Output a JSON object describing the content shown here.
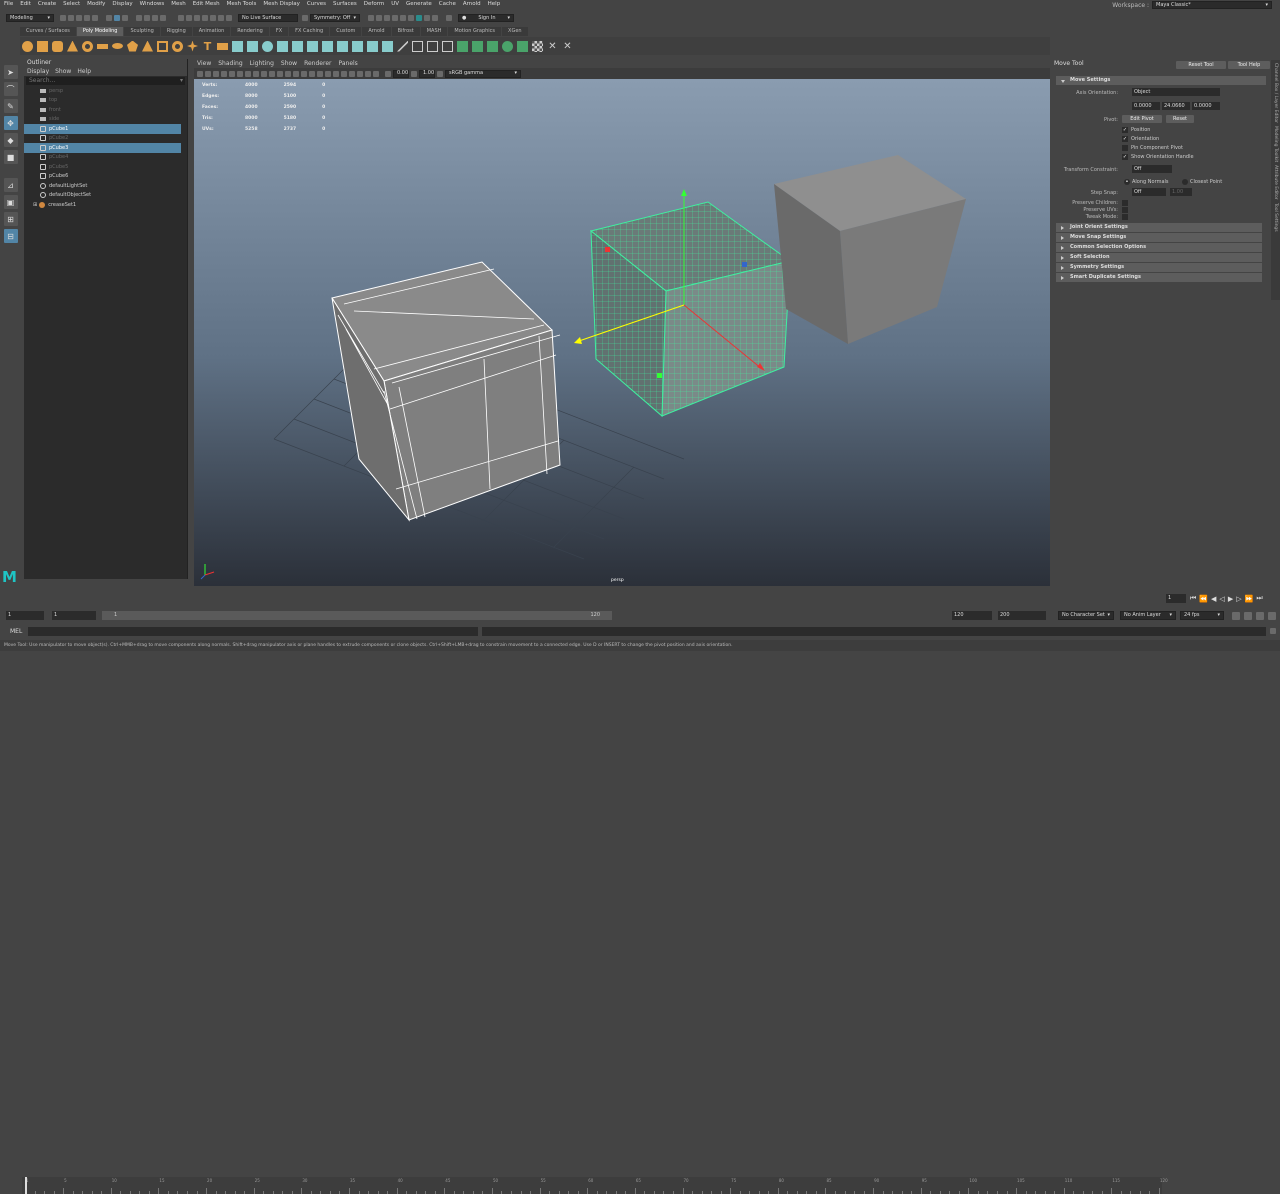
{
  "menubar": {
    "items": [
      "File",
      "Edit",
      "Create",
      "Select",
      "Modify",
      "Display",
      "Windows",
      "Mesh",
      "Edit Mesh",
      "Mesh Tools",
      "Mesh Display",
      "Curves",
      "Surfaces",
      "Deform",
      "UV",
      "Generate",
      "Cache",
      "Arnold",
      "Help"
    ],
    "workspace_label": "Workspace :",
    "workspace_value": "Maya Classic*"
  },
  "statusline": {
    "mode": "Modeling",
    "live_surface": "No Live Surface",
    "symmetry": "Symmetry: Off",
    "sign_in": "Sign In"
  },
  "shelf": {
    "tabs": [
      "Curves / Surfaces",
      "Poly Modeling",
      "Sculpting",
      "Rigging",
      "Animation",
      "Rendering",
      "FX",
      "FX Caching",
      "Custom",
      "Arnold",
      "Bifrost",
      "MASH",
      "Motion Graphics",
      "XGen"
    ],
    "active_tab": "Poly Modeling"
  },
  "outliner": {
    "title": "Outliner",
    "menu": [
      "Display",
      "Show",
      "Help"
    ],
    "search_placeholder": "Search...",
    "items": [
      {
        "label": "persp",
        "dim": true,
        "selected": false,
        "type": "camera"
      },
      {
        "label": "top",
        "dim": true,
        "selected": false,
        "type": "camera"
      },
      {
        "label": "front",
        "dim": true,
        "selected": false,
        "type": "camera"
      },
      {
        "label": "side",
        "dim": true,
        "selected": false,
        "type": "camera"
      },
      {
        "label": "pCube1",
        "dim": false,
        "selected": true,
        "type": "mesh"
      },
      {
        "label": "pCube2",
        "dim": true,
        "selected": false,
        "type": "mesh"
      },
      {
        "label": "pCube3",
        "dim": false,
        "selected": true,
        "type": "mesh"
      },
      {
        "label": "pCube4",
        "dim": true,
        "selected": false,
        "type": "mesh"
      },
      {
        "label": "pCube5",
        "dim": true,
        "selected": false,
        "type": "mesh"
      },
      {
        "label": "pCube6",
        "dim": false,
        "selected": false,
        "type": "mesh"
      },
      {
        "label": "defaultLightSet",
        "dim": false,
        "selected": false,
        "type": "set"
      },
      {
        "label": "defaultObjectSet",
        "dim": false,
        "selected": false,
        "type": "set"
      },
      {
        "label": "creaseSet1",
        "dim": false,
        "selected": false,
        "type": "crease"
      }
    ]
  },
  "viewport": {
    "menu": [
      "View",
      "Shading",
      "Lighting",
      "Show",
      "Renderer",
      "Panels"
    ],
    "exposure": "0.00",
    "gamma": "1.00",
    "color_space": "sRGB gamma",
    "camera_label": "persp",
    "hud": [
      {
        "label": "Verts:",
        "a": "4000",
        "b": "2594",
        "c": "0"
      },
      {
        "label": "Edges:",
        "a": "8000",
        "b": "5100",
        "c": "0"
      },
      {
        "label": "Faces:",
        "a": "4000",
        "b": "2590",
        "c": "0"
      },
      {
        "label": "Tris:",
        "a": "8000",
        "b": "5180",
        "c": "0"
      },
      {
        "label": "UVs:",
        "a": "5258",
        "b": "2737",
        "c": "0"
      }
    ]
  },
  "tool_settings": {
    "title": "Move Tool",
    "reset_label": "Reset Tool",
    "help_label": "Tool Help",
    "section_move": "Move Settings",
    "axis_orientation_label": "Axis Orientation:",
    "axis_orientation_value": "Object",
    "values": [
      "0.0000",
      "24.0660",
      "0.0000"
    ],
    "pivot_label": "Pivot:",
    "edit_pivot": "Edit Pivot",
    "reset": "Reset",
    "checks": [
      {
        "label": "Position",
        "checked": true
      },
      {
        "label": "Orientation",
        "checked": true
      },
      {
        "label": "Pin Component Pivot",
        "checked": false
      },
      {
        "label": "Show Orientation Handle",
        "checked": true
      }
    ],
    "transform_constraint_label": "Transform Constraint:",
    "transform_constraint_value": "Off",
    "along_normals": "Along Normals",
    "closest_point": "Closest Point",
    "step_snap_label": "Step Snap:",
    "step_snap_value": "Off",
    "step_snap_amount": "1.00",
    "preserve_children": "Preserve Children:",
    "preserve_uvs": "Preserve UVs:",
    "tweak_mode": "Tweak Mode:",
    "sections": [
      "Joint Orient Settings",
      "Move Snap Settings",
      "Common Selection Options",
      "Soft Selection",
      "Symmetry Settings",
      "Smart Duplicate Settings"
    ],
    "side_tabs": [
      "Channel Box / Layer Editor",
      "Modeling Toolkit",
      "Attribute Editor",
      "Tool Settings"
    ]
  },
  "timeslider": {
    "ticks": [
      "1",
      "5",
      "10",
      "15",
      "20",
      "25",
      "30",
      "35",
      "40",
      "45",
      "50",
      "55",
      "60",
      "65",
      "70",
      "75",
      "80",
      "85",
      "90",
      "95",
      "100",
      "105",
      "110",
      "115",
      "120"
    ],
    "current_frame": "1"
  },
  "rangebar": {
    "start": "1",
    "inner_start": "1",
    "range_start": "1",
    "range_end": "120",
    "end": "120",
    "anim_end": "200",
    "character_set": "No Character Set",
    "anim_layer": "No Anim Layer",
    "fps": "24 fps"
  },
  "cmdline": {
    "label": "MEL"
  },
  "helpline": {
    "text": "Move Tool: Use manipulator to move object(s). Ctrl+MMB+drag to move components along normals. Shift+drag manipulator axis or plane handles to extrude components or clone objects. Ctrl+Shift+LMB+drag to constrain movement to a connected edge. Use D or INSERT to change the pivot position and axis orientation."
  },
  "colors": {
    "accent": "#5285a6",
    "green": "#3ff0a0",
    "shelf_orange": "#e0a048",
    "maya_logo": "#1fc4c4"
  }
}
